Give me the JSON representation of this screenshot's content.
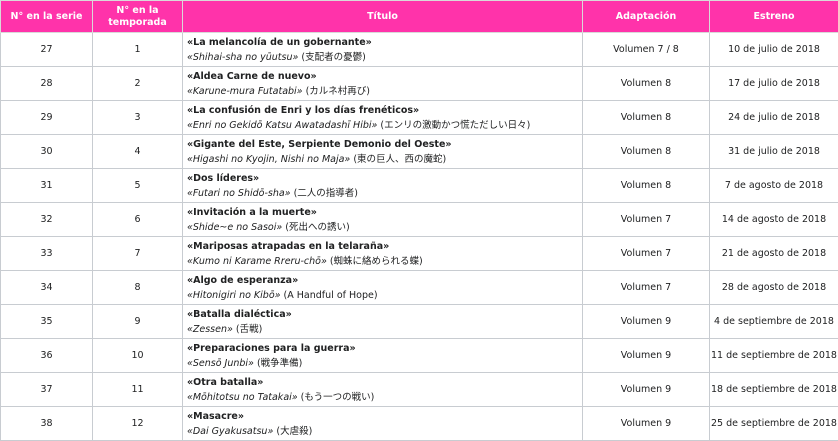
{
  "headers": {
    "series_no": "N° en la serie",
    "season_no": "N° en la temporada",
    "title": "Título",
    "adaptation": "Adaptación",
    "premiere": "Estreno"
  },
  "episodes": [
    {
      "series": "27",
      "season": "1",
      "title": "«La melancolía de un gobernante»",
      "romaji": "«Shihai-sha no yūutsu»",
      "native": "(支配者の憂鬱)",
      "adaptation": "Volumen 7 / 8",
      "premiere": "10 de julio de 2018"
    },
    {
      "series": "28",
      "season": "2",
      "title": "«Aldea Carne de nuevo»",
      "romaji": "«Karune-mura Futatabi»",
      "native": "(カルネ村再び)",
      "adaptation": "Volumen 8",
      "premiere": "17 de julio de 2018"
    },
    {
      "series": "29",
      "season": "3",
      "title": "«La confusión de Enri y los días frenéticos»",
      "romaji": "«Enri no Gekidō Katsu Awatadashī Hibi»",
      "native": "(エンリの激動かつ慌ただしい日々)",
      "adaptation": "Volumen 8",
      "premiere": "24 de julio de 2018"
    },
    {
      "series": "30",
      "season": "4",
      "title": "«Gigante del Este, Serpiente Demonio del Oeste»",
      "romaji": "«Higashi no Kyojin, Nishi no Maja»",
      "native": "(東の巨人、西の魔蛇)",
      "adaptation": "Volumen 8",
      "premiere": "31 de julio de 2018"
    },
    {
      "series": "31",
      "season": "5",
      "title": "«Dos líderes»",
      "romaji": "«Futari no Shidō-sha»",
      "native": "(二人の指導者)",
      "adaptation": "Volumen 8",
      "premiere": "7 de agosto de 2018"
    },
    {
      "series": "32",
      "season": "6",
      "title": "«Invitación a la muerte»",
      "romaji": "«Shide~e no Sasoi»",
      "native": "(死出への誘い)",
      "adaptation": "Volumen 7",
      "premiere": "14 de agosto de 2018"
    },
    {
      "series": "33",
      "season": "7",
      "title": "«Mariposas atrapadas en la telaraña»",
      "romaji": "«Kumo ni Karame Rreru-chō»",
      "native": "(蜘蛛に絡められる蝶)",
      "adaptation": "Volumen 7",
      "premiere": "21 de agosto de 2018"
    },
    {
      "series": "34",
      "season": "8",
      "title": "«Algo de esperanza»",
      "romaji": "«Hitonigiri no Kibō»",
      "native": "(A Handful of Hope)",
      "adaptation": "Volumen 7",
      "premiere": "28 de agosto de 2018"
    },
    {
      "series": "35",
      "season": "9",
      "title": "«Batalla dialéctica»",
      "romaji": "«Zessen»",
      "native": "(舌戦)",
      "adaptation": "Volumen 9",
      "premiere": "4 de septiembre de 2018"
    },
    {
      "series": "36",
      "season": "10",
      "title": "«Preparaciones para la guerra»",
      "romaji": "«Sensō Junbi»",
      "native": "(戦争準備)",
      "adaptation": "Volumen 9",
      "premiere": "11 de septiembre de 2018"
    },
    {
      "series": "37",
      "season": "11",
      "title": "«Otra batalla»",
      "romaji": "«Mōhitotsu no Tatakai»",
      "native": "(もう一つの戦い)",
      "adaptation": "Volumen 9",
      "premiere": "18 de septiembre de 2018"
    },
    {
      "series": "38",
      "season": "12",
      "title": "«Masacre»",
      "romaji": "«Dai Gyakusatsu»",
      "native": "(大虐殺)",
      "adaptation": "Volumen 9",
      "premiere": "25 de septiembre de 2018"
    }
  ]
}
